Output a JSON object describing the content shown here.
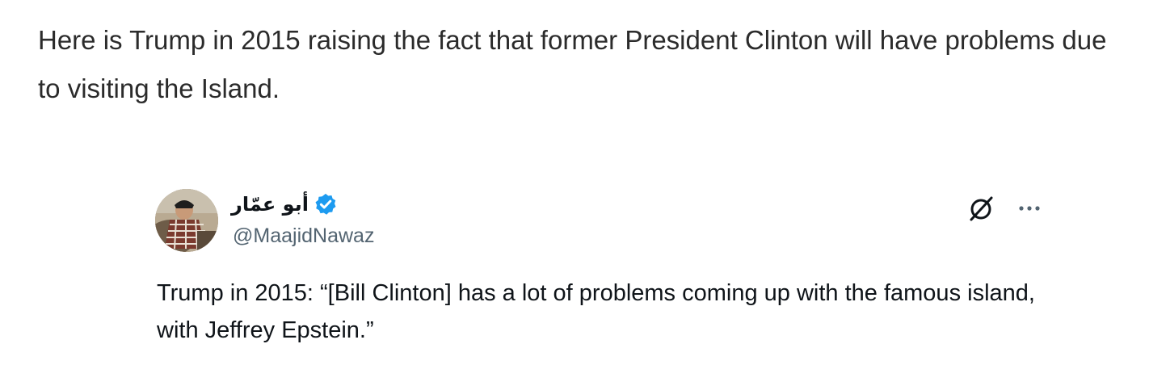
{
  "post": {
    "text": "Here is Trump in 2015 raising the fact that former President Clinton will have problems due to visiting the Island."
  },
  "tweet": {
    "display_name": "أبو عمّار",
    "handle": "@MaajidNawaz",
    "verified": true,
    "text": "Trump in 2015: “[Bill Clinton] has a lot of problems coming up with the famous island, with Jeffrey Epstein.”",
    "icons": {
      "avatar": "avatar",
      "verified": "verified-badge-icon",
      "grok": "grok-icon",
      "more": "more-options-icon"
    },
    "colors": {
      "verified": "#1d9bf0",
      "handle": "#536471",
      "text": "#0f1419"
    }
  }
}
